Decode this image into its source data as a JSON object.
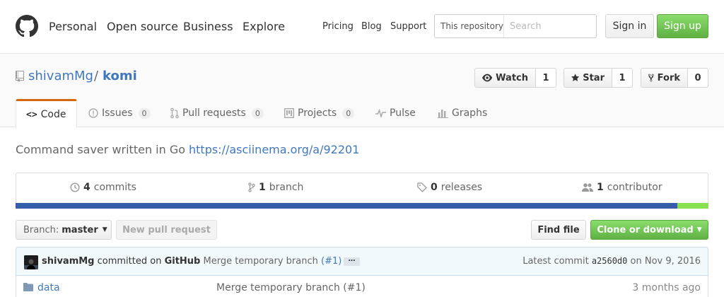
{
  "header": {
    "nav_main": [
      "Personal",
      "Open source",
      "Business",
      "Explore"
    ],
    "nav_sub": [
      "Pricing",
      "Blog",
      "Support"
    ],
    "search": {
      "scope": "This repository",
      "placeholder": "Search",
      "value": ""
    },
    "sign_in": "Sign in",
    "sign_up": "Sign up"
  },
  "repo": {
    "owner": "shivamMg",
    "separator": "/",
    "name": "komi",
    "watch": {
      "label": "Watch",
      "count": "1"
    },
    "star": {
      "label": "Star",
      "count": "1"
    },
    "fork": {
      "label": "Fork",
      "count": "0"
    }
  },
  "tabs": [
    {
      "label": "Code",
      "icon": "code-icon",
      "active": true
    },
    {
      "label": "Issues",
      "count": "0",
      "icon": "issue-icon"
    },
    {
      "label": "Pull requests",
      "count": "0",
      "icon": "pull-request-icon"
    },
    {
      "label": "Projects",
      "count": "0",
      "icon": "project-icon"
    },
    {
      "label": "Pulse",
      "icon": "pulse-icon"
    },
    {
      "label": "Graphs",
      "icon": "graph-icon"
    }
  ],
  "description": {
    "text": "Command saver written in Go",
    "link": "https://asciinema.org/a/92201"
  },
  "summary": {
    "commits": {
      "count": "4",
      "label": "commits"
    },
    "branches": {
      "count": "1",
      "label": "branch"
    },
    "releases": {
      "count": "0",
      "label": "releases"
    },
    "contributors": {
      "count": "1",
      "label": "contributor"
    }
  },
  "languages": {
    "go_color": "#375eab",
    "other_color": "#89e051",
    "go_share": 0.955
  },
  "toolbar": {
    "branch_label": "Branch:",
    "branch_value": "master",
    "new_pr": "New pull request",
    "find_file": "Find file",
    "clone": "Clone or download"
  },
  "latest_commit": {
    "author": "shivamMg",
    "action": "committed on",
    "platform": "GitHub",
    "message": "Merge temporary branch",
    "pr": "(#1)",
    "ellipsis": "…",
    "latest_label": "Latest commit",
    "sha": "a2560d0",
    "date_prefix": "on",
    "date": "Nov 9, 2016"
  },
  "files": [
    {
      "name": "data",
      "type": "folder",
      "message": "Merge temporary branch (#1)",
      "age": "3 months ago"
    }
  ]
}
